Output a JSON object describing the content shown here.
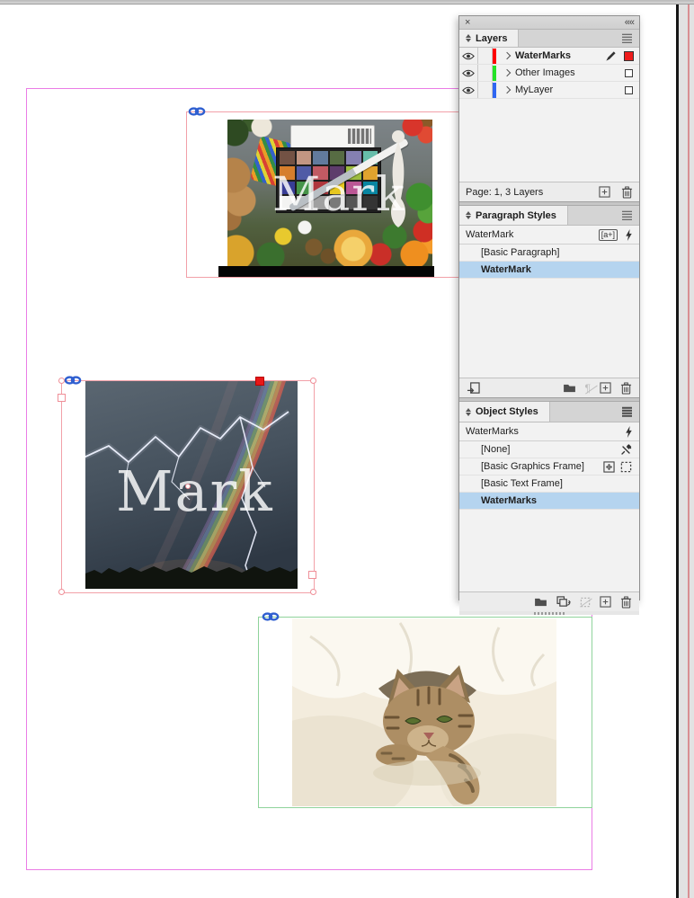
{
  "canvas": {
    "watermark_text": "Mark",
    "colors": {
      "margin_guide": "#ea7ce5",
      "bleed_guide": "#d98f93",
      "watermarks_frame": "#f2a0a8",
      "other_images_frame": "#8fd39b",
      "selection_handle_red": "#e81718",
      "page_edge": "#161616",
      "pasteboard": "#e2e2e2"
    },
    "colorchecker": [
      "#735244",
      "#c29682",
      "#627a9d",
      "#576c43",
      "#8580b1",
      "#67bdaa",
      "#d67e2c",
      "#505ba6",
      "#c15a63",
      "#5e3c6c",
      "#9dbc40",
      "#e0a32e",
      "#383d96",
      "#469449",
      "#af363c",
      "#e7c71f",
      "#bb5695",
      "#0885a1",
      "#f3f3f2",
      "#c8c8c8",
      "#a0a0a0",
      "#7a7a79",
      "#555555",
      "#343434"
    ]
  },
  "panel_group": {
    "close_glyph": "×",
    "collapse_glyph": "«"
  },
  "layers_panel": {
    "tab_label": "Layers",
    "rows": [
      {
        "label": "WaterMarks",
        "color": "#fe0000"
      },
      {
        "label": "Other Images",
        "color": "#24e227"
      },
      {
        "label": "MyLayer",
        "color": "#2f66f2"
      }
    ],
    "status": "Page: 1, 3 Layers"
  },
  "paragraph_styles_panel": {
    "tab_label": "Paragraph Styles",
    "current_style": "WaterMark",
    "new_style_badge": "a+",
    "rows": [
      {
        "label": "[Basic Paragraph]"
      },
      {
        "label": "WaterMark"
      }
    ]
  },
  "object_styles_panel": {
    "tab_label": "Object Styles",
    "current_style": "WaterMarks",
    "rows": [
      {
        "label": "[None]"
      },
      {
        "label": "[Basic Graphics Frame]"
      },
      {
        "label": "[Basic Text Frame]"
      },
      {
        "label": "WaterMarks"
      }
    ]
  }
}
